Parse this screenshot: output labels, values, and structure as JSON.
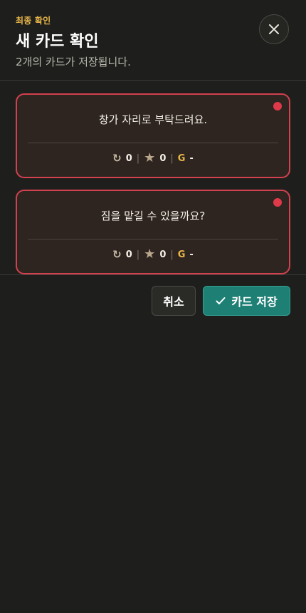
{
  "header": {
    "eyebrow": "최종 확인",
    "title": "새 카드 확인",
    "subtitle": "2개의 카드가 저장됩니다.",
    "close_icon": "close-icon"
  },
  "cards": [
    {
      "text": "창가 자리로 부탁드려요.",
      "repeat_count": "0",
      "star_count": "0",
      "grade_label": "G",
      "grade_value": "-"
    },
    {
      "text": "짐을 맡길 수 있을까요?",
      "repeat_count": "0",
      "star_count": "0",
      "grade_label": "G",
      "grade_value": "-"
    }
  ],
  "footer": {
    "cancel_label": "취소",
    "save_label": "카드 저장",
    "save_icon": "check-icon"
  },
  "colors": {
    "background": "#1e1f1c",
    "accent_yellow": "#e7b64a",
    "card_border": "#d2414f",
    "card_dot": "#e0394a",
    "card_bg": "#2e2520",
    "save_button": "#1e7f74"
  }
}
